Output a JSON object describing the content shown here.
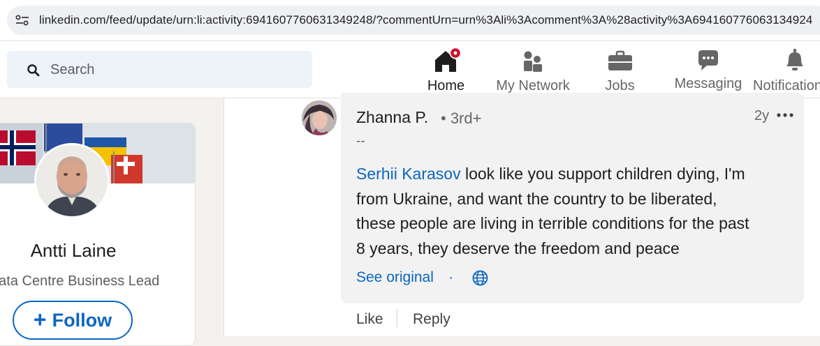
{
  "browser": {
    "url": "linkedin.com/feed/update/urn:li:activity:6941607760631349248/?commentUrn=urn%3Ali%3Acomment%3A%28activity%3A694160776063134924"
  },
  "header": {
    "search_placeholder": "Search",
    "nav": [
      {
        "label": "Home",
        "icon": "home-icon",
        "active": true
      },
      {
        "label": "My Network",
        "icon": "network-icon"
      },
      {
        "label": "Jobs",
        "icon": "briefcase-icon"
      },
      {
        "label": "Messaging",
        "icon": "message-icon"
      },
      {
        "label": "Notifications",
        "icon": "bell-icon"
      }
    ],
    "accent_color": "#0a66c2",
    "notification_dot_color": "#cb112d"
  },
  "profile_card": {
    "name": "Antti Laine",
    "headline": "Data Centre Business Lead",
    "follow_label": "Follow"
  },
  "comment": {
    "author": "Zhanna P.",
    "degree": "• 3rd+",
    "headline": "--",
    "time": "2y",
    "mention": "Serhii Karasov",
    "text_line1": " look like you support children dying, I'm",
    "text_line2": "from Ukraine, and want the country to be liberated,",
    "text_line3": "these people are living in terrible conditions for the past",
    "text_line4": "8 years, they deserve the freedom and peace",
    "see_original": "See original",
    "separator": "·"
  },
  "actions": {
    "like": "Like",
    "reply": "Reply"
  }
}
